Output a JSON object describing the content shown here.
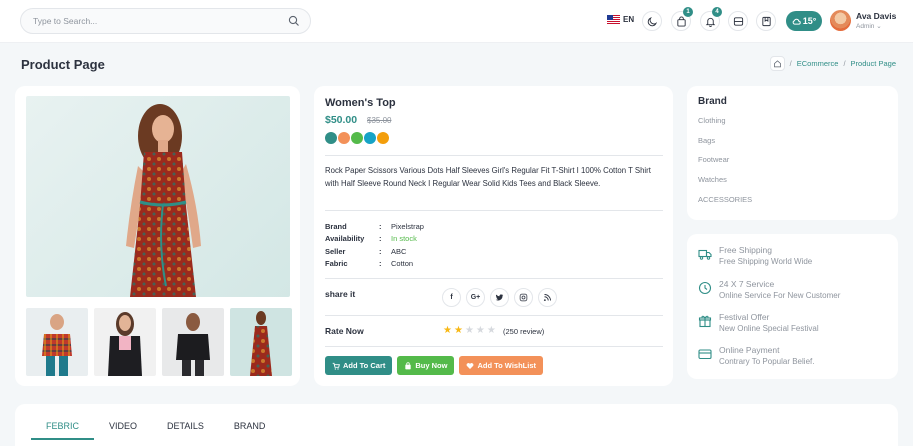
{
  "header": {
    "search_placeholder": "Type to Search...",
    "language": "EN",
    "cart_count": "1",
    "notifications_count": "4",
    "weather": "15°",
    "user_name": "Ava Davis",
    "user_role": "Admin"
  },
  "page": {
    "title": "Product Page",
    "breadcrumb": [
      "ECommerce",
      "/",
      "Product Page"
    ]
  },
  "product": {
    "name": "Women's Top",
    "price": "$50.00",
    "old_price": "$35.00",
    "colors": [
      "#308e87",
      "#f39159",
      "#54ba4a",
      "#16a3c6",
      "#f39e0b"
    ],
    "description": "Rock Paper Scissors Various Dots Half Sleeves Girl's Regular Fit T-Shirt I 100% Cotton T Shirt with Half Sleeve Round Neck I Regular Wear Solid Kids Tees and Black Sleeve.",
    "specs": [
      {
        "key": "Brand",
        "sep": ":",
        "value": "Pixelstrap"
      },
      {
        "key": "Availability",
        "sep": ":",
        "value": "In stock"
      },
      {
        "key": "Seller",
        "sep": ":",
        "value": "ABC"
      },
      {
        "key": "Fabric",
        "sep": ":",
        "value": "Cotton"
      }
    ],
    "share_label": "share it",
    "social": [
      "f",
      "G+",
      "t",
      "ig",
      "rss"
    ],
    "rate_label": "Rate Now",
    "rating": 2,
    "rating_max": 5,
    "reviews": "(250 review)",
    "buttons": {
      "add_to_cart": "Add To Cart",
      "buy_now": "Buy Now",
      "wishlist": "Add To WishList"
    }
  },
  "brand": {
    "title": "Brand",
    "items": [
      "Clothing",
      "Bags",
      "Footwear",
      "Watches",
      "ACCESSORIES"
    ]
  },
  "services": [
    {
      "icon": "truck-icon",
      "title": "Free Shipping",
      "subtitle": "Free Shipping World Wide"
    },
    {
      "icon": "clock-icon",
      "title": "24 X 7 Service",
      "subtitle": "Online Service For New Customer"
    },
    {
      "icon": "gift-icon",
      "title": "Festival Offer",
      "subtitle": "New Online Special Festival"
    },
    {
      "icon": "credit-card-icon",
      "title": "Online Payment",
      "subtitle": "Contrary To Popular Belief."
    }
  ],
  "tabs": [
    "FEBRIC",
    "VIDEO",
    "DETAILS",
    "BRAND"
  ],
  "active_tab": "FEBRIC",
  "accent": "#308e87"
}
